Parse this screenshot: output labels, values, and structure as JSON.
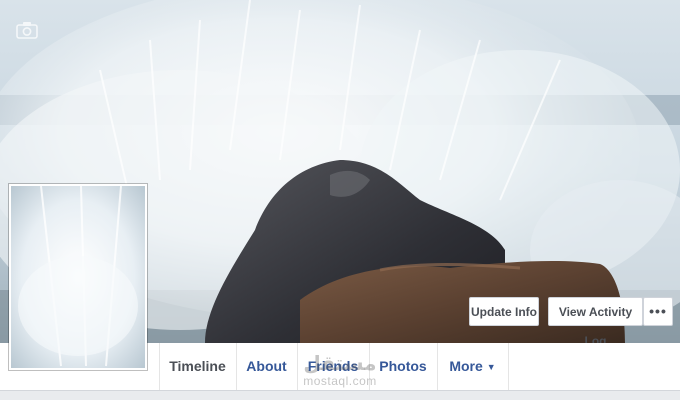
{
  "cover": {
    "camera_icon": "camera-icon"
  },
  "actions": {
    "update_info": "Update Info",
    "view_activity_log": "View Activity Log",
    "more_options": "•••"
  },
  "nav": {
    "tabs": [
      {
        "label": "Timeline",
        "active": true
      },
      {
        "label": "About"
      },
      {
        "label": "Friends"
      },
      {
        "label": "Photos"
      },
      {
        "label": "More",
        "caret": "▼"
      }
    ]
  },
  "watermark": {
    "arabic": "مستقل",
    "domain": "mostaql.com"
  },
  "colors": {
    "link_blue": "#365899",
    "active_tab": "#4b4f56",
    "background": "#e9ebee"
  }
}
